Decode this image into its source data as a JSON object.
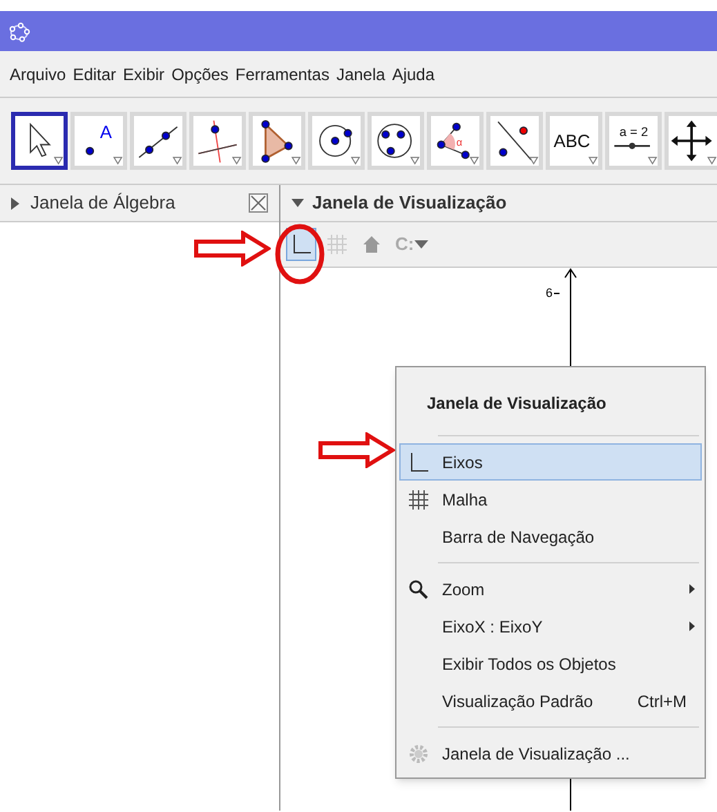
{
  "menu_bar": [
    "Arquivo",
    "Editar",
    "Exibir",
    "Opções",
    "Ferramentas",
    "Janela",
    "Ajuda"
  ],
  "toolbar": [
    {
      "kind": "move",
      "selected": true
    },
    {
      "kind": "point",
      "label": "A",
      "selected": false
    },
    {
      "kind": "line",
      "selected": false
    },
    {
      "kind": "perpendicular",
      "selected": false
    },
    {
      "kind": "polygon",
      "selected": false
    },
    {
      "kind": "circle",
      "selected": false
    },
    {
      "kind": "circle3",
      "selected": false
    },
    {
      "kind": "angle",
      "label": "α",
      "selected": false
    },
    {
      "kind": "reflect",
      "selected": false
    },
    {
      "kind": "text",
      "label": "ABC",
      "selected": false
    },
    {
      "kind": "slider",
      "label": "a = 2",
      "selected": false
    },
    {
      "kind": "pan",
      "selected": false
    }
  ],
  "algebra_panel": {
    "title": "Janela de Álgebra"
  },
  "graphics_panel": {
    "title": "Janela de Visualização",
    "style_bar": [
      {
        "kind": "axes",
        "selected": true
      },
      {
        "kind": "grid",
        "selected": false
      },
      {
        "kind": "home",
        "selected": false
      },
      {
        "kind": "capture",
        "label": "C:",
        "selected": false
      }
    ],
    "y_axis_label": "6"
  },
  "context_menu": {
    "title": "Janela de Visualização",
    "items": [
      {
        "kind": "separator"
      },
      {
        "kind": "axes",
        "label": "Eixos",
        "selected": true
      },
      {
        "kind": "grid",
        "label": "Malha",
        "selected": false
      },
      {
        "kind": "item",
        "label": "Barra de Navegação",
        "selected": false
      },
      {
        "kind": "separator"
      },
      {
        "kind": "zoom",
        "label": "Zoom",
        "submenu": true,
        "selected": false
      },
      {
        "kind": "item",
        "label": "EixoX : EixoY",
        "submenu": true,
        "selected": false
      },
      {
        "kind": "item",
        "label": "Exibir Todos os Objetos",
        "selected": false
      },
      {
        "kind": "item",
        "label": "Visualização Padrão",
        "shortcut": "Ctrl+M",
        "selected": false
      },
      {
        "kind": "separator"
      },
      {
        "kind": "settings",
        "label": "Janela de Visualização ...",
        "selected": false
      }
    ]
  }
}
